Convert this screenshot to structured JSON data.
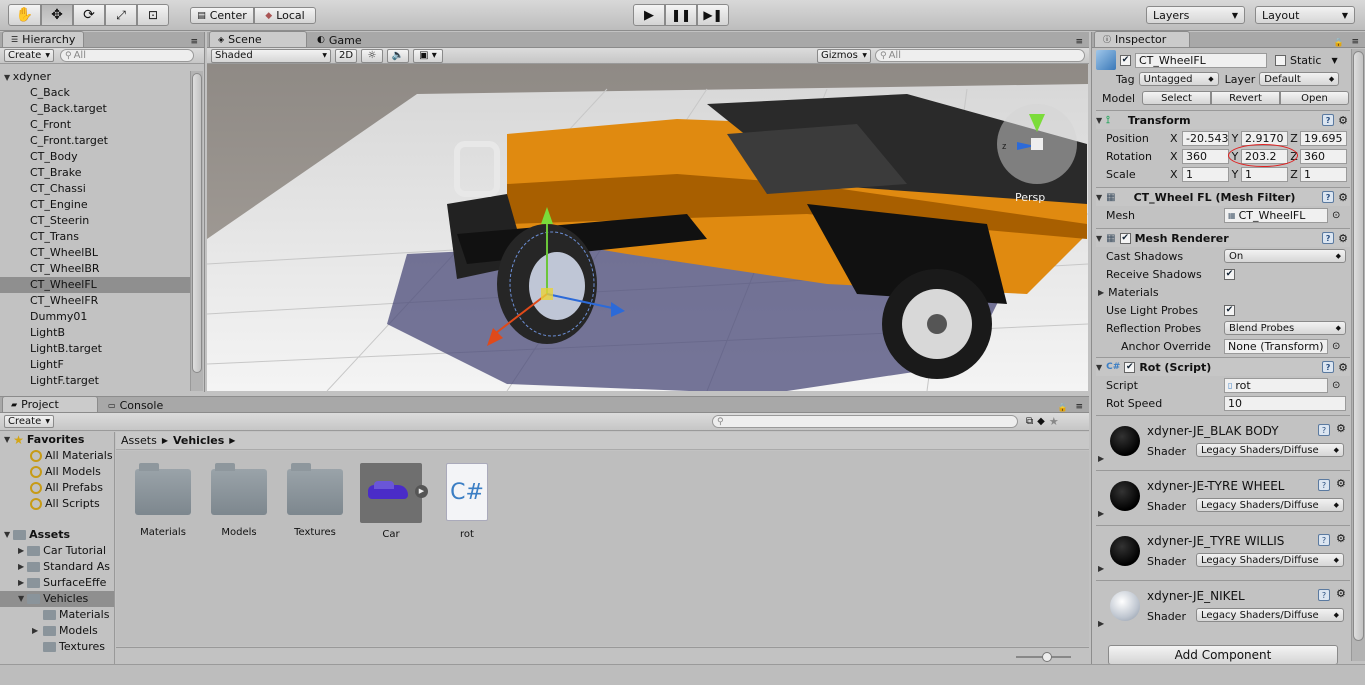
{
  "toolbar": {
    "tools": [
      "hand-tool",
      "move-tool",
      "rotate-tool",
      "scale-tool",
      "rect-tool"
    ],
    "pivot_label": "Center",
    "space_label": "Local",
    "play_icons": [
      "play-icon",
      "pause-icon",
      "step-icon"
    ],
    "layers_label": "Layers",
    "layout_label": "Layout"
  },
  "hierarchy": {
    "tab_label": "Hierarchy",
    "create_label": "Create",
    "search_placeholder": "All",
    "root": "xdyner",
    "items": [
      "C_Back",
      "C_Back.target",
      "C_Front",
      "C_Front.target",
      "CT_Body",
      "CT_Brake",
      "CT_Chassi",
      "CT_Engine",
      "CT_Steerin",
      "CT_Trans",
      "CT_WheelBL",
      "CT_WheelBR",
      "CT_WheelFL",
      "CT_WheelFR",
      "Dummy01",
      "LightB",
      "LightB.target",
      "LightF",
      "LightF.target"
    ],
    "selected": "CT_WheelFL"
  },
  "scene": {
    "tab_label": "Scene",
    "game_tab_label": "Game",
    "shading_mode": "Shaded",
    "mode_2d": "2D",
    "gizmos_label": "Gizmos",
    "search_placeholder": "All",
    "persp_label": "Persp"
  },
  "inspector": {
    "tab_label": "Inspector",
    "object_name": "CT_WheelFL",
    "static_label": "Static",
    "tag_label": "Tag",
    "tag_value": "Untagged",
    "layer_label": "Layer",
    "layer_value": "Default",
    "model_label": "Model",
    "model_buttons": [
      "Select",
      "Revert",
      "Open"
    ],
    "transform": {
      "title": "Transform",
      "position_label": "Position",
      "rotation_label": "Rotation",
      "scale_label": "Scale",
      "axis_labels": [
        "X",
        "Y",
        "Z"
      ],
      "position": [
        "-20.543",
        "2.9170",
        "19.695"
      ],
      "rotation": [
        "360",
        "203.2",
        "360"
      ],
      "scale": [
        "1",
        "1",
        "1"
      ]
    },
    "mesh_filter": {
      "title": "CT_Wheel FL (Mesh Filter)",
      "mesh_label": "Mesh",
      "mesh_value": "CT_WheelFL"
    },
    "mesh_renderer": {
      "title": "Mesh Renderer",
      "cast_shadows_label": "Cast Shadows",
      "cast_shadows_value": "On",
      "receive_shadows_label": "Receive Shadows",
      "materials_label": "Materials",
      "use_light_probes_label": "Use Light Probes",
      "reflection_probes_label": "Reflection Probes",
      "reflection_probes_value": "Blend Probes",
      "anchor_override_label": "Anchor Override",
      "anchor_override_value": "None (Transform)"
    },
    "rot_script": {
      "title": "Rot (Script)",
      "script_label": "Script",
      "script_value": "rot",
      "rot_speed_label": "Rot Speed",
      "rot_speed_value": "10"
    },
    "materials": [
      {
        "name": "xdyner-JE_BLAK BODY",
        "shader_label": "Shader",
        "shader": "Legacy Shaders/Diffuse",
        "color": "black"
      },
      {
        "name": "xdyner-JE-TYRE WHEEL",
        "shader_label": "Shader",
        "shader": "Legacy Shaders/Diffuse",
        "color": "black"
      },
      {
        "name": "xdyner-JE_TYRE WILLIS",
        "shader_label": "Shader",
        "shader": "Legacy Shaders/Diffuse",
        "color": "black"
      },
      {
        "name": "xdyner-JE_NIKEL",
        "shader_label": "Shader",
        "shader": "Legacy Shaders/Diffuse",
        "color": "white"
      }
    ],
    "add_component_label": "Add Component"
  },
  "project": {
    "tab_label": "Project",
    "console_tab_label": "Console",
    "create_label": "Create",
    "favorites_label": "Favorites",
    "favorites": [
      "All Materials",
      "All Models",
      "All Prefabs",
      "All Scripts"
    ],
    "assets_label": "Assets",
    "asset_tree": [
      "Car Tutorial",
      "Standard As",
      "SurfaceEffe",
      "Vehicles"
    ],
    "vehicles_children": [
      "Materials",
      "Models",
      "Textures"
    ],
    "breadcrumb": [
      "Assets",
      "Vehicles"
    ],
    "grid_items": [
      {
        "label": "Materials",
        "kind": "folder"
      },
      {
        "label": "Models",
        "kind": "folder"
      },
      {
        "label": "Textures",
        "kind": "folder"
      },
      {
        "label": "Car",
        "kind": "prefab"
      },
      {
        "label": "rot",
        "kind": "script"
      }
    ]
  },
  "colors": {
    "jeep_orange": "#e08a10",
    "annotation_red": "#e02020",
    "selection_gray": "#8f8f8f"
  }
}
